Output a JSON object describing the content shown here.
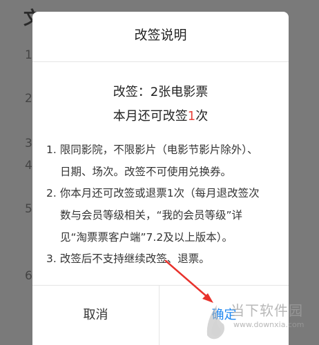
{
  "dialog": {
    "title": "改签说明",
    "summary_line1": "改签：2张电影票",
    "summary_line2_prefix": "本月还可改签",
    "summary_line2_count": "1",
    "summary_line2_suffix": "次",
    "rules": [
      "1. 限同影院，不限影片（电影节影片除外）、",
      "日期、场次。改签不可使用兑换券。",
      "2. 你本月还可改签或退票1次（每月退改签次",
      "数与会员等级相关，“我的会员等级”详",
      "见“淘票票客户端”7.2及以上版本）。",
      "3. 改签后不支持继续改签、退票。"
    ],
    "cancel_label": "取消",
    "confirm_label": "确定"
  },
  "watermark": {
    "text": "当下软件园",
    "url": "www.downxia.com"
  },
  "colors": {
    "highlight": "#e8413b",
    "confirm": "#1e87f0",
    "arrow": "#e8322c"
  }
}
